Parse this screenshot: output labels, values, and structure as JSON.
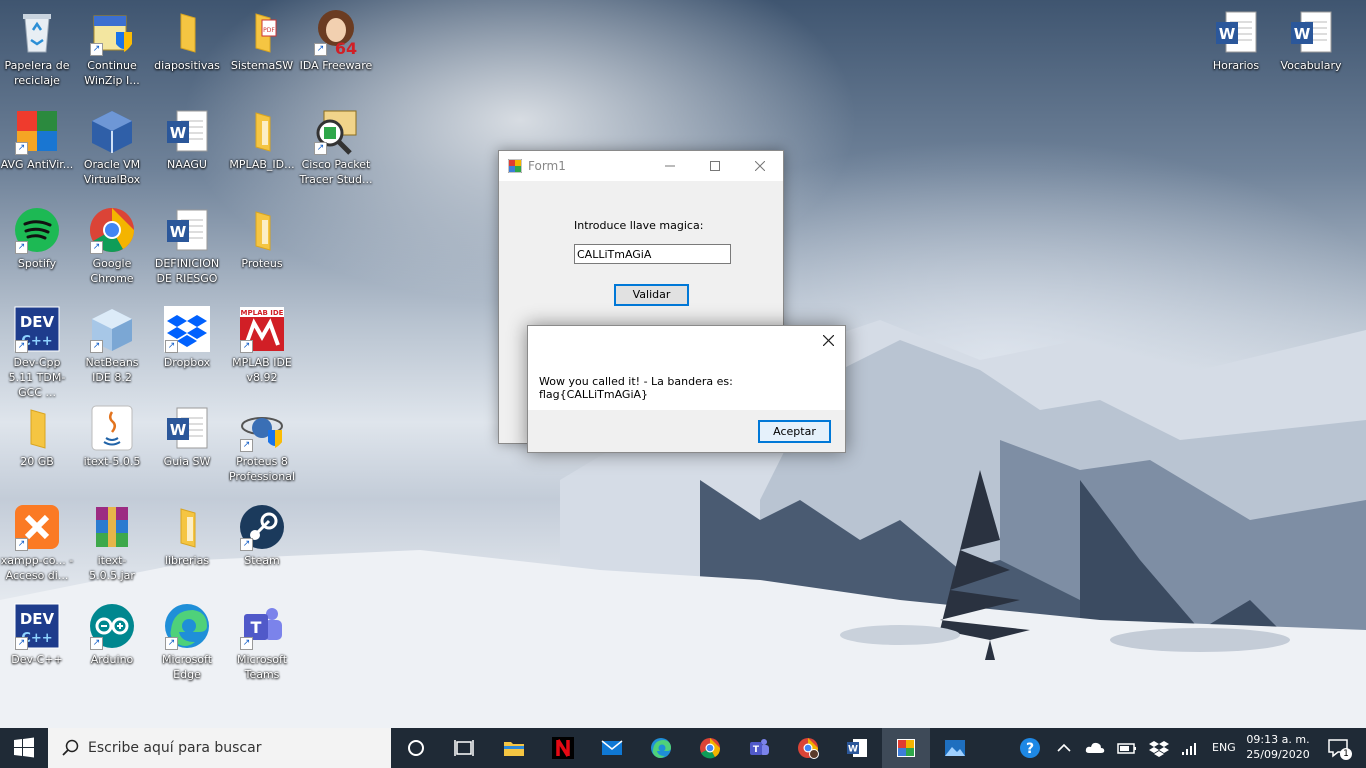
{
  "desktop": {
    "icons": [
      {
        "label": "Papelera de reciclaje"
      },
      {
        "label": "Continue WinZip I..."
      },
      {
        "label": "diapositivas"
      },
      {
        "label": "SistemaSW"
      },
      {
        "label": "IDA Freeware"
      },
      {
        "label": "AVG AntiVir..."
      },
      {
        "label": "Oracle VM VirtualBox"
      },
      {
        "label": "NAAGU"
      },
      {
        "label": "MPLAB_ID..."
      },
      {
        "label": "Cisco Packet Tracer Stud..."
      },
      {
        "label": "Spotify"
      },
      {
        "label": "Google Chrome"
      },
      {
        "label": "DEFINICION DE RIESGO"
      },
      {
        "label": "Proteus"
      },
      {
        "label": "Dev-Cpp 5.11 TDM-GCC ..."
      },
      {
        "label": "NetBeans IDE 8.2"
      },
      {
        "label": "Dropbox"
      },
      {
        "label": "MPLAB IDE v8.92"
      },
      {
        "label": "20 GB"
      },
      {
        "label": "itext-5.0.5"
      },
      {
        "label": "Guia SW"
      },
      {
        "label": "Proteus 8 Professional"
      },
      {
        "label": "xampp-co... - Acceso di..."
      },
      {
        "label": "itext-5.0.5.jar"
      },
      {
        "label": "librerias"
      },
      {
        "label": "Steam"
      },
      {
        "label": "Dev-C++"
      },
      {
        "label": "Arduino"
      },
      {
        "label": "Microsoft Edge"
      },
      {
        "label": "Microsoft Teams"
      },
      {
        "label": "Horarios"
      },
      {
        "label": "Vocabulary"
      }
    ]
  },
  "form1": {
    "title": "Form1",
    "prompt_label": "Introduce llave magica:",
    "input_value": "CALLiTmAGiA",
    "validate_button": "Validar"
  },
  "messagebox": {
    "message": "Wow you called it! - La bandera es: flag{CALLiTmAGiA}",
    "ok_button": "Aceptar"
  },
  "taskbar": {
    "search_placeholder": "Escribe aquí para buscar",
    "language": "ENG",
    "time": "09:13 a. m.",
    "date": "25/09/2020",
    "notifications_count": "1"
  },
  "colors": {
    "accent": "#0078d7",
    "taskbar": "#1f2a36"
  }
}
